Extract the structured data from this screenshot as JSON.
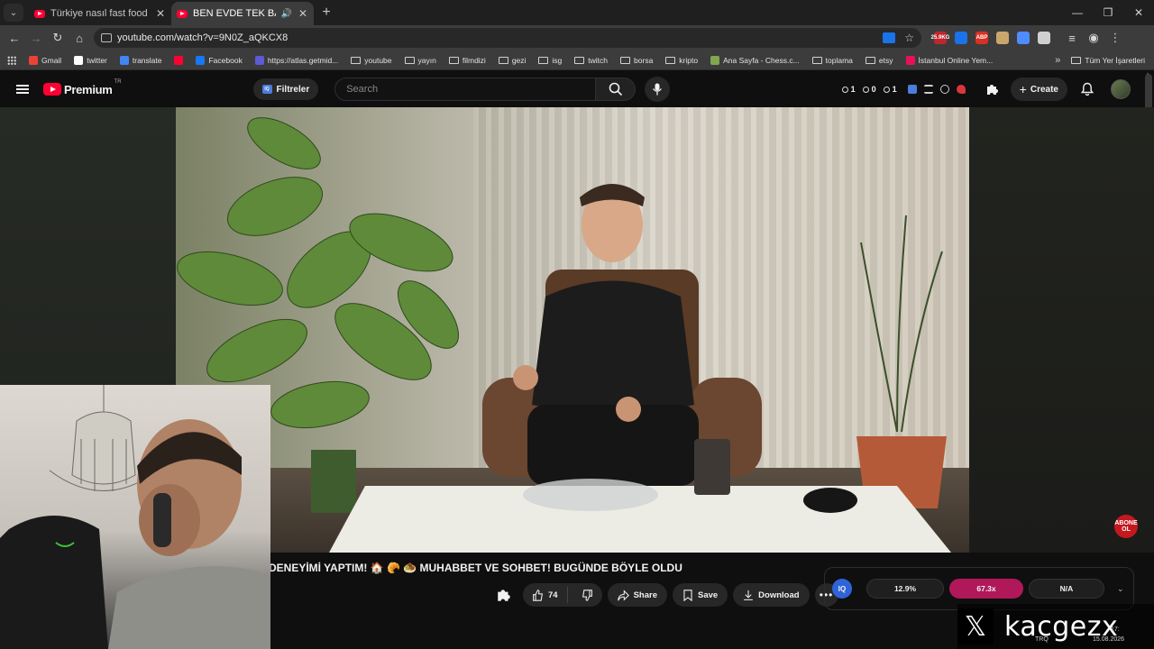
{
  "browser": {
    "tabs": [
      {
        "title": "Türkiye nasıl fast food ülkesi ol",
        "active": false
      },
      {
        "title": "BEN EVDE TEK BAŞIMA KRI",
        "active": true
      }
    ],
    "url": "youtube.com/watch?v=9N0Z_aQKCX8",
    "extensions": [
      {
        "name": "red-badge-extension",
        "badge": "25.9KG",
        "color": "#c0262d"
      },
      {
        "name": "translate-extension",
        "color": "#1a73e8"
      },
      {
        "name": "adblock-extension",
        "badge": "ABP",
        "color": "#d93025"
      },
      {
        "name": "face-extension",
        "color": "#c9a66b"
      },
      {
        "name": "wave-extension",
        "color": "#4d8dff"
      },
      {
        "name": "puzzle-extension",
        "color": "#d0d0d0"
      }
    ],
    "bookmarks": [
      {
        "label": "Gmail",
        "type": "site",
        "color": "#ea4335"
      },
      {
        "label": "twitter",
        "type": "site",
        "color": "#ffffff"
      },
      {
        "label": "translate",
        "type": "site",
        "color": "#4285f4"
      },
      {
        "label": "",
        "type": "site",
        "color": "#ff0033"
      },
      {
        "label": "Facebook",
        "type": "site",
        "color": "#1877f2"
      },
      {
        "label": "https://atlas.getmid...",
        "type": "site",
        "color": "#5b5bd6"
      },
      {
        "label": "youtube",
        "type": "folder"
      },
      {
        "label": "yayın",
        "type": "folder"
      },
      {
        "label": "filmdizi",
        "type": "folder"
      },
      {
        "label": "gezi",
        "type": "folder"
      },
      {
        "label": "isg",
        "type": "folder"
      },
      {
        "label": "twitch",
        "type": "folder"
      },
      {
        "label": "borsa",
        "type": "folder"
      },
      {
        "label": "kripto",
        "type": "folder"
      },
      {
        "label": "Ana Sayfa - Chess.c...",
        "type": "site",
        "color": "#7fa650"
      },
      {
        "label": "toplama",
        "type": "folder"
      },
      {
        "label": "etsy",
        "type": "folder"
      },
      {
        "label": "İstanbul Online Yem...",
        "type": "site",
        "color": "#e8105a"
      }
    ],
    "all_bookmarks_label": "Tüm Yer İşaretleri"
  },
  "youtube": {
    "logo_text": "Premium",
    "country_code": "TR",
    "filter_label": "Filtreler",
    "search_placeholder": "Search",
    "stats": [
      {
        "icon": "clock-icon",
        "value": "1"
      },
      {
        "icon": "eye-icon",
        "value": "0"
      },
      {
        "icon": "eye-icon",
        "value": "1"
      }
    ],
    "create_label": "Create",
    "video_title": "DENEYİMİ YAPTIM! 🏠 🥐 🧆 MUHABBET VE SOHBET! BUGÜNDE BÖYLE OLDU",
    "like_count": "74",
    "share_label": "Share",
    "save_label": "Save",
    "download_label": "Download",
    "iq_badge": "IQ",
    "iq_metrics": [
      "12.9%",
      "67.3x",
      "N/A"
    ],
    "abone_line1": "ABONE",
    "abone_line2": "OL"
  },
  "overlay": {
    "x_handle": "kacgezx",
    "tray_lang": "TRQ",
    "tray_time": "17:",
    "tray_date": "15.08.2026"
  },
  "colors": {
    "accent_red": "#ff0033",
    "iq_highlight": "#b0185a",
    "iq_blue": "#2f64d8"
  }
}
